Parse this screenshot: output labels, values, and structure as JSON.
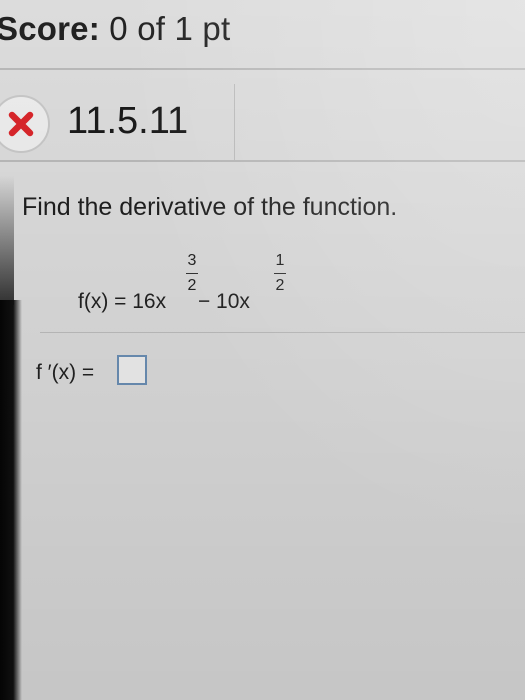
{
  "header": {
    "score_label": "Score:",
    "score_value": "0 of 1 pt"
  },
  "question": {
    "status": "incorrect",
    "status_icon": "x-icon",
    "status_color": "#d9262b",
    "number": "11.5.11",
    "prompt": "Find the derivative of the function.",
    "function_text": "f(x) = 16x",
    "function_mid": " − 10x",
    "exponent_1": {
      "numerator": "3",
      "denominator": "2"
    },
    "exponent_2": {
      "numerator": "1",
      "denominator": "2"
    },
    "answer_label": "f ′(x) ="
  },
  "colors": {
    "answer_box_border": "#6b8fb5",
    "rule": "#b9b9b9"
  }
}
